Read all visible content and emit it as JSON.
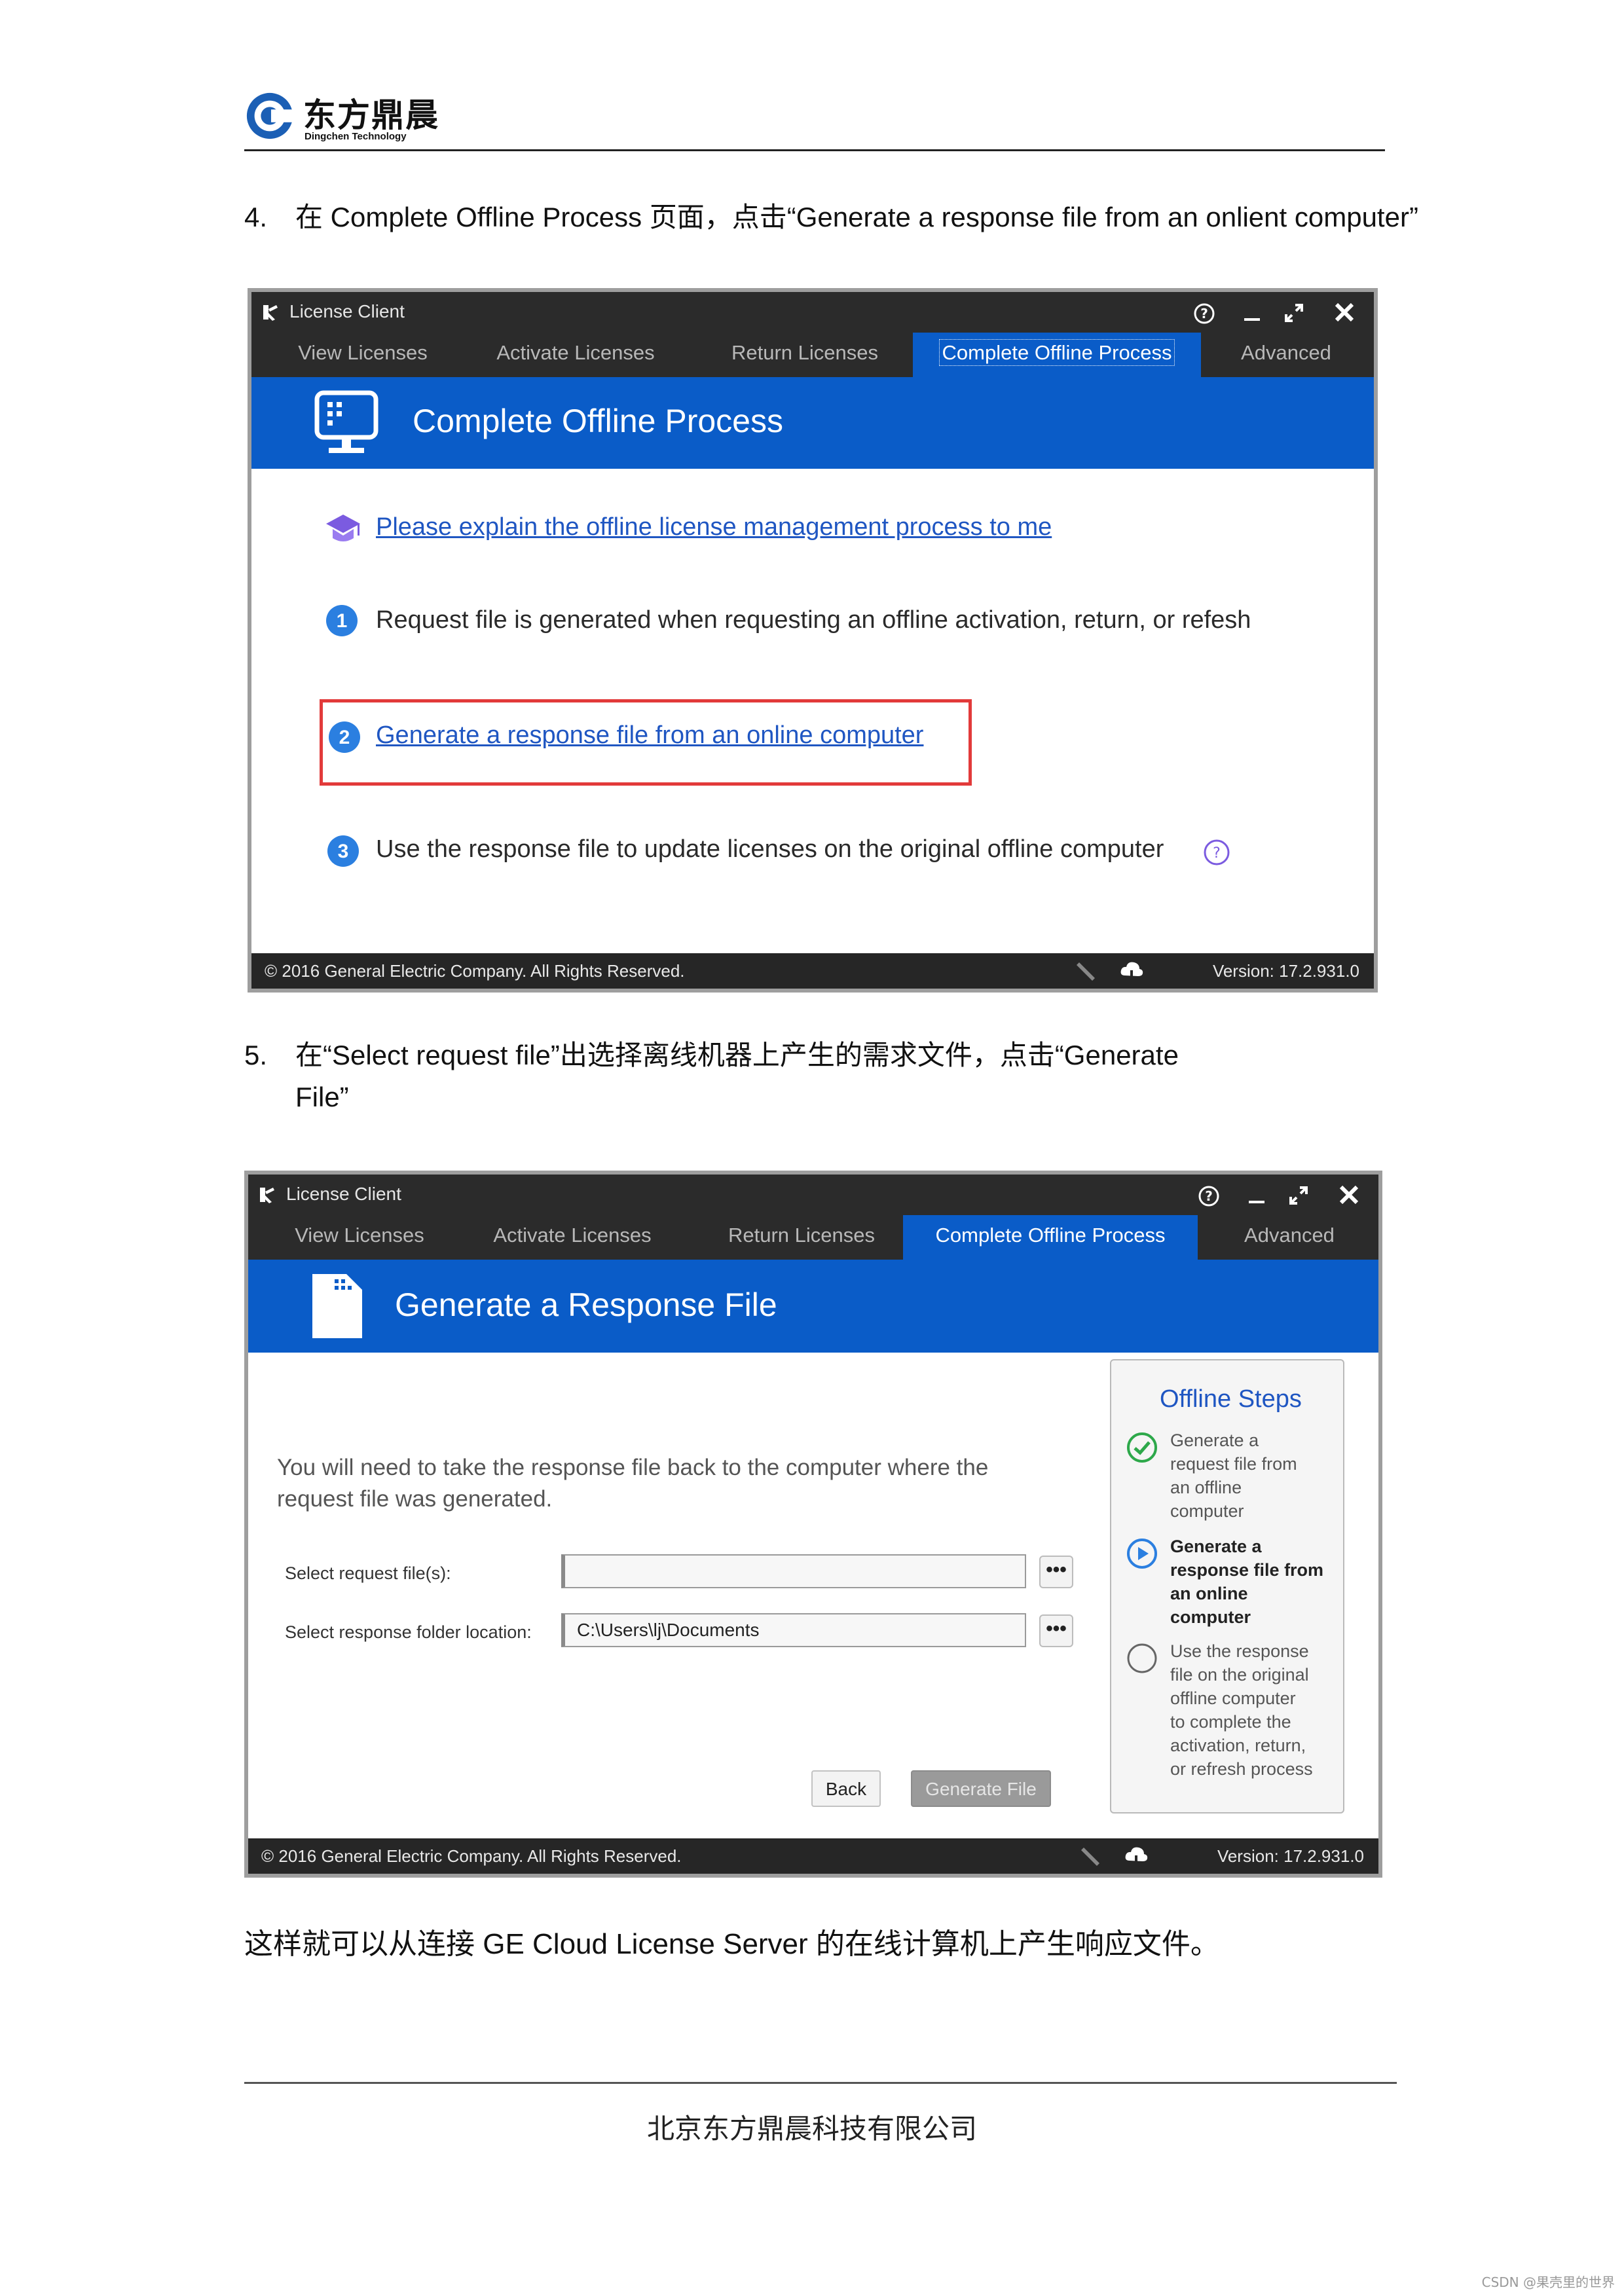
{
  "header": {
    "logo_cn": "东方鼎晨",
    "logo_en": "Dingchen Technology"
  },
  "step4": {
    "num": "4.",
    "text": "在 Complete Offline Process 页面，点击“Generate a response file from an onlient computer”"
  },
  "window1": {
    "title": "License Client",
    "tabs": [
      "View Licenses",
      "Activate Licenses",
      "Return Licenses",
      "Complete Offline Process",
      "Advanced"
    ],
    "active_tab": 3,
    "banner_title": "Complete Offline Process",
    "explain_link": "Please explain the offline license management process to me",
    "item1_num": "1",
    "item1_text": "Request file is generated when requesting an offline activation, return, or refesh",
    "item2_num": "2",
    "item2_link": "Generate a response file from an online computer",
    "item3_num": "3",
    "item3_text": "Use the response file to update licenses on the original offline computer",
    "copyright": "© 2016 General Electric Company.  All Rights Reserved.",
    "version": "Version:  17.2.931.0",
    "highlight_color": "#e23a3a",
    "accent_color": "#0a5cc8"
  },
  "step5": {
    "num": "5.",
    "line1": "在“Select request file”出选择离线机器上产生的需求文件，点击“Generate",
    "line2": "File”"
  },
  "window2": {
    "title": "License Client",
    "tabs": [
      "View Licenses",
      "Activate Licenses",
      "Return Licenses",
      "Complete Offline Process",
      "Advanced"
    ],
    "active_tab": 3,
    "banner_title": "Generate a Response File",
    "instruction_line1": "You will need to take the response file back to the computer where the",
    "instruction_line2": "request file was generated.",
    "request_label": "Select request file(s):",
    "request_value": "",
    "response_label": "Select response folder location:",
    "response_value": "C:\\Users\\lj\\Documents",
    "browse_label": "•••",
    "back_label": "Back",
    "generate_label": "Generate File",
    "steps_title": "Offline Steps",
    "steps": [
      {
        "state": "done",
        "icon": "check-circle-icon",
        "lines": [
          "Generate a",
          "request file from",
          "an offline",
          "computer"
        ]
      },
      {
        "state": "current",
        "icon": "play-circle-icon",
        "lines": [
          "Generate a",
          "response file from",
          "an online",
          "computer"
        ]
      },
      {
        "state": "pending",
        "icon": "empty-circle-icon",
        "lines": [
          "Use the response",
          "file on the original",
          "offline computer",
          "to complete the",
          "activation, return,",
          "or refresh process"
        ]
      }
    ],
    "copyright": "© 2016 General Electric Company.  All Rights Reserved.",
    "version": "Version:  17.2.931.0"
  },
  "closing": "这样就可以从连接 GE Cloud License Server 的在线计算机上产生响应文件。",
  "footer": {
    "company": "北京东方鼎晨科技有限公司"
  },
  "watermark": "CSDN @果壳里的世界"
}
